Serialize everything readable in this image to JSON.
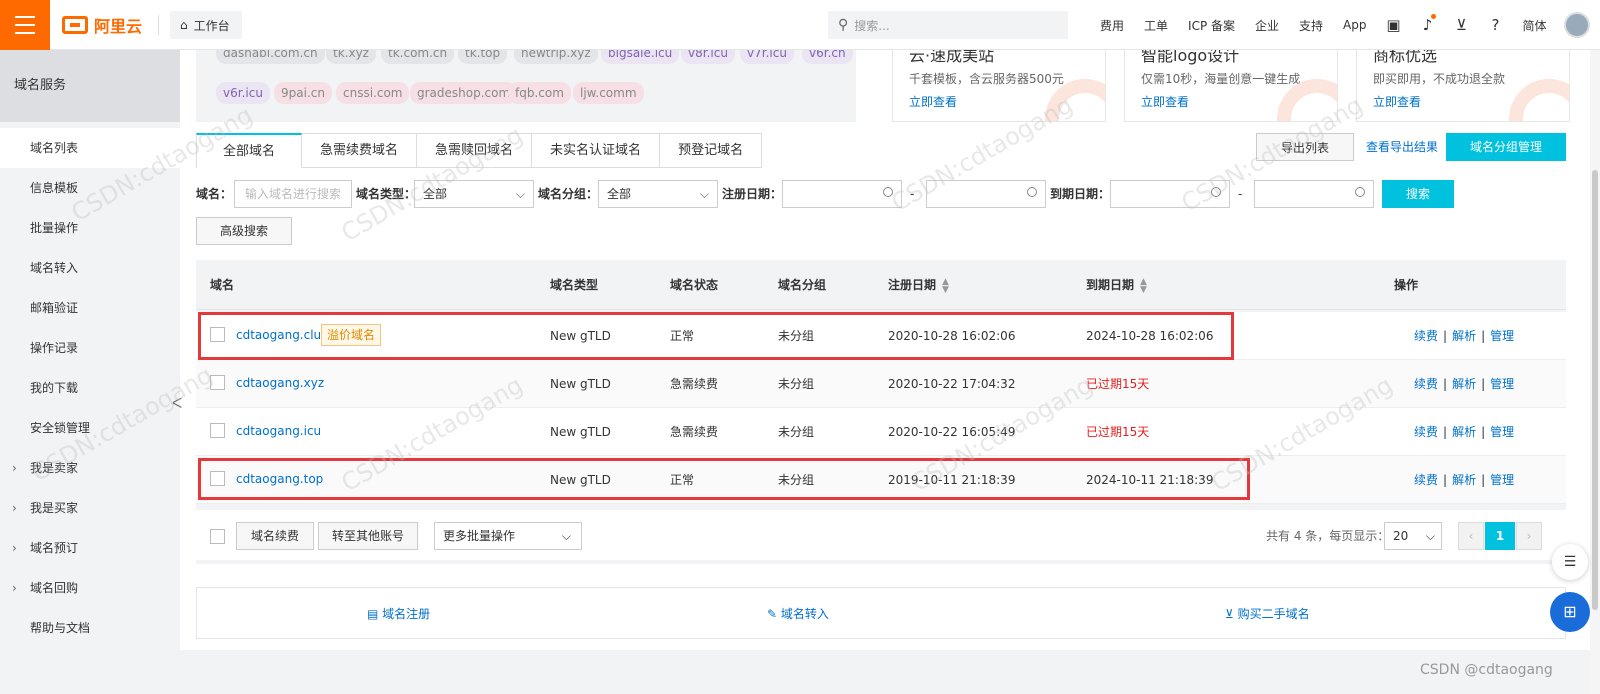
{
  "topbar": {
    "logo_text": "阿里云",
    "workbench": "工作台",
    "search_placeholder": "搜索...",
    "links": [
      "费用",
      "工单",
      "ICP 备案",
      "企业",
      "支持",
      "App"
    ],
    "lang": "简体",
    "brand_color": "#ff6a00"
  },
  "sidebar": {
    "title": "域名服务",
    "items": [
      {
        "label": "域名列表"
      },
      {
        "label": "信息模板"
      },
      {
        "label": "批量操作"
      },
      {
        "label": "域名转入"
      },
      {
        "label": "邮箱验证"
      },
      {
        "label": "操作记录"
      },
      {
        "label": "我的下载"
      },
      {
        "label": "安全锁管理"
      },
      {
        "label": "我是卖家"
      },
      {
        "label": "我是买家"
      },
      {
        "label": "域名预订"
      },
      {
        "label": "域名回购"
      },
      {
        "label": "帮助与文档"
      }
    ]
  },
  "tags": [
    "dashabi.com.cn",
    "tk.xyz",
    "tk.com.cn",
    "tk.top",
    "newtrip.xyz",
    "bigsale.icu",
    "v8r.icu",
    "v7r.icu",
    "v6r.cn",
    "v6r.icu",
    "9pai.cn",
    "cnssi.com",
    "gradeshop.com",
    "fqb.com",
    "ljw.comm"
  ],
  "promos": [
    {
      "title": "云·速成美站",
      "desc": "千套模板，含云服务器500元",
      "link": "立即查看"
    },
    {
      "title": "智能logo设计",
      "desc": "仅需10秒，海量创意一键生成",
      "link": "立即查看"
    },
    {
      "title": "商标优选",
      "desc": "即买即用，不成功退全款",
      "link": "立即查看"
    }
  ],
  "tabs": [
    "全部域名",
    "急需续费域名",
    "急需赎回域名",
    "未实名认证域名",
    "预登记域名"
  ],
  "actions": {
    "export": "导出列表",
    "export_result": "查看导出结果",
    "group_manage": "域名分组管理"
  },
  "filters": {
    "domain_label": "域名：",
    "domain_placeholder": "输入域名进行搜索",
    "type_label": "域名类型：",
    "type_value": "全部",
    "group_label": "域名分组：",
    "group_value": "全部",
    "reg_label": "注册日期：",
    "exp_label": "到期日期：",
    "dash": "-",
    "search": "搜索",
    "advanced": "高级搜索"
  },
  "table": {
    "headers": [
      "域名",
      "域名类型",
      "域名状态",
      "域名分组",
      "注册日期",
      "到期日期",
      "操作"
    ],
    "premium_label": "溢价域名",
    "ops": [
      "续费",
      "解析",
      "管理"
    ],
    "sep": "|",
    "rows": [
      {
        "domain": "cdtaogang.club",
        "type": "New gTLD",
        "status": "正常",
        "group": "未分组",
        "reg": "2020-10-28 16:02:06",
        "exp": "2024-10-28 16:02:06"
      },
      {
        "domain": "cdtaogang.xyz",
        "type": "New gTLD",
        "status": "急需续费",
        "group": "未分组",
        "reg": "2020-10-22 17:04:32",
        "exp": "已过期15天"
      },
      {
        "domain": "cdtaogang.icu",
        "type": "New gTLD",
        "status": "急需续费",
        "group": "未分组",
        "reg": "2020-10-22 16:05:49",
        "exp": "已过期15天"
      },
      {
        "domain": "cdtaogang.top",
        "type": "New gTLD",
        "status": "正常",
        "group": "未分组",
        "reg": "2019-10-11 21:18:39",
        "exp": "2024-10-11 21:18:39"
      }
    ]
  },
  "batch": {
    "renew": "域名续费",
    "transfer": "转至其他账号",
    "more": "更多批量操作"
  },
  "pager": {
    "summary": "共有 4 条，每页显示：",
    "size": "20",
    "page": "1",
    "prev": "‹",
    "next": "›"
  },
  "footer": {
    "register": "域名注册",
    "transfer_in": "域名转入",
    "buy_second_hand": "购买二手域名"
  },
  "watermark": "CSDN @cdtaogang",
  "watermark_tile": "CSDN:cdtaogang",
  "accent_color": "#00c1de",
  "highlight_color": "#e4393c"
}
